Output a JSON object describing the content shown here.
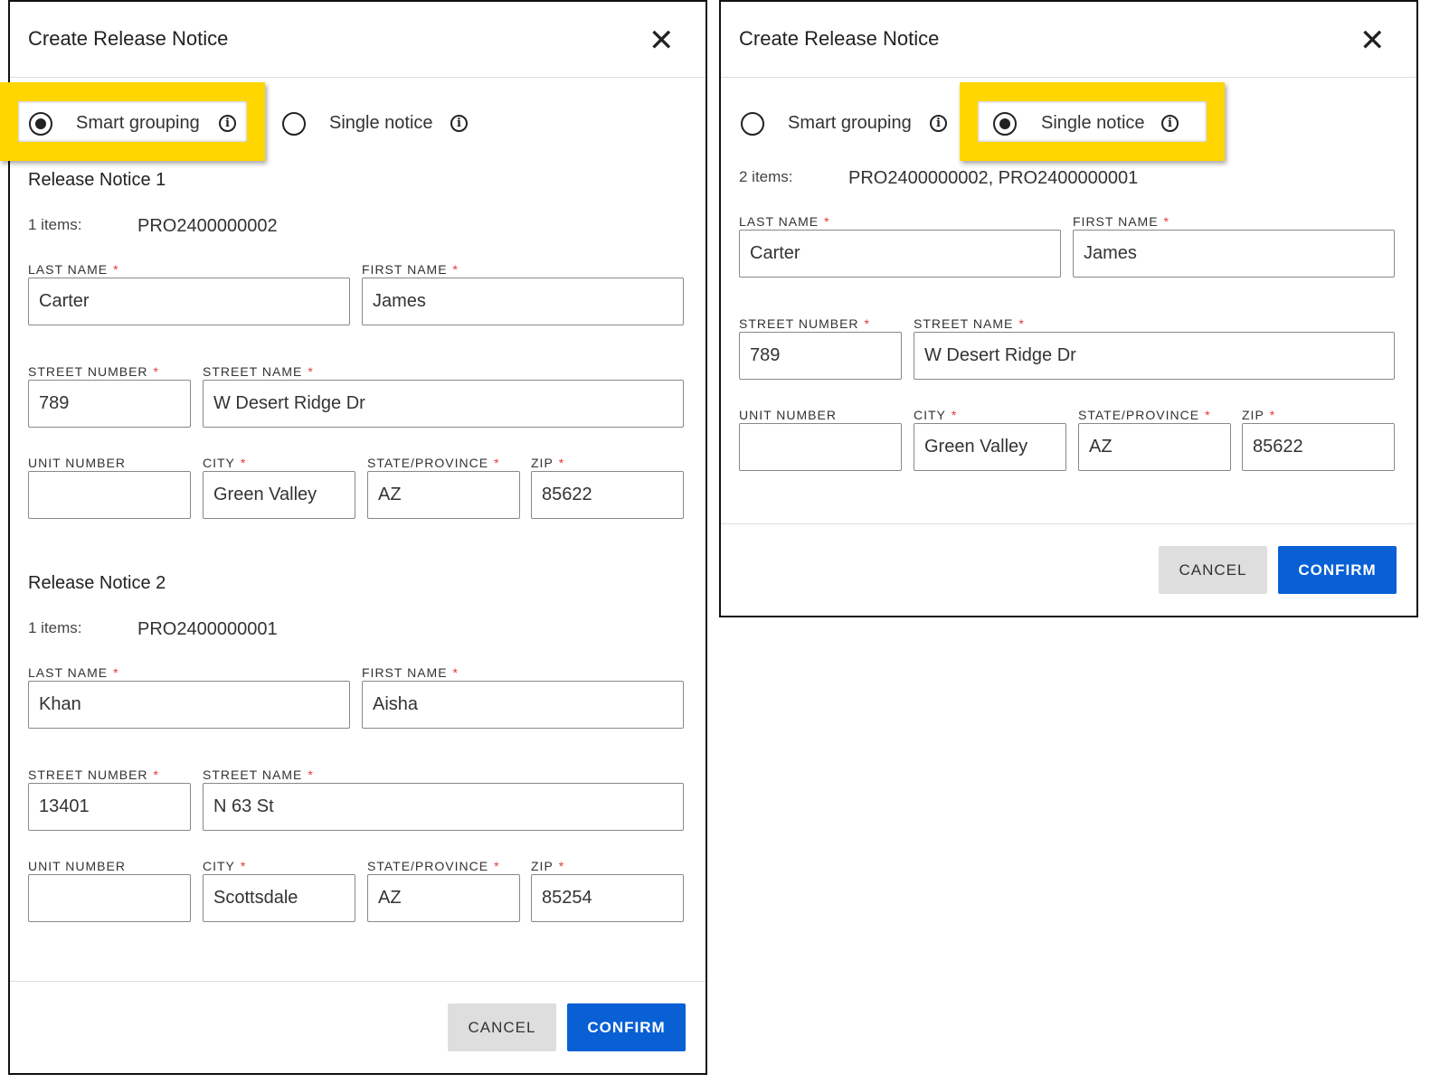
{
  "left": {
    "title": "Create Release Notice",
    "options": [
      {
        "label": "Smart grouping",
        "selected": true
      },
      {
        "label": "Single notice",
        "selected": false
      }
    ],
    "notices": [
      {
        "heading": "Release Notice 1",
        "items_label": "1 items:",
        "items_value": "PRO2400000002",
        "fields": {
          "last_name": {
            "label": "LAST NAME",
            "value": "Carter"
          },
          "first_name": {
            "label": "FIRST NAME",
            "value": "James"
          },
          "street_number": {
            "label": "STREET NUMBER",
            "value": "789"
          },
          "street_name": {
            "label": "STREET NAME",
            "value": "W Desert Ridge Dr"
          },
          "unit_number": {
            "label": "UNIT NUMBER",
            "value": ""
          },
          "city": {
            "label": "CITY",
            "value": "Green Valley"
          },
          "state": {
            "label": "STATE/PROVINCE",
            "value": "AZ"
          },
          "zip": {
            "label": "ZIP",
            "value": "85622"
          }
        }
      },
      {
        "heading": "Release Notice 2",
        "items_label": "1 items:",
        "items_value": "PRO2400000001",
        "fields": {
          "last_name": {
            "label": "LAST NAME",
            "value": "Khan"
          },
          "first_name": {
            "label": "FIRST NAME",
            "value": "Aisha"
          },
          "street_number": {
            "label": "STREET NUMBER",
            "value": "13401"
          },
          "street_name": {
            "label": "STREET NAME",
            "value": "N 63 St"
          },
          "unit_number": {
            "label": "UNIT NUMBER",
            "value": ""
          },
          "city": {
            "label": "CITY",
            "value": "Scottsdale"
          },
          "state": {
            "label": "STATE/PROVINCE",
            "value": "AZ"
          },
          "zip": {
            "label": "ZIP",
            "value": "85254"
          }
        }
      }
    ],
    "cancel": "CANCEL",
    "confirm": "CONFIRM"
  },
  "right": {
    "title": "Create Release Notice",
    "options": [
      {
        "label": "Smart grouping",
        "selected": false
      },
      {
        "label": "Single notice",
        "selected": true
      }
    ],
    "notices": [
      {
        "items_label": "2 items:",
        "items_value": "PRO2400000002, PRO2400000001",
        "fields": {
          "last_name": {
            "label": "LAST NAME",
            "value": "Carter"
          },
          "first_name": {
            "label": "FIRST NAME",
            "value": "James"
          },
          "street_number": {
            "label": "STREET NUMBER",
            "value": "789"
          },
          "street_name": {
            "label": "STREET NAME",
            "value": "W Desert Ridge Dr"
          },
          "unit_number": {
            "label": "UNIT NUMBER",
            "value": ""
          },
          "city": {
            "label": "CITY",
            "value": "Green Valley"
          },
          "state": {
            "label": "STATE/PROVINCE",
            "value": "AZ"
          },
          "zip": {
            "label": "ZIP",
            "value": "85622"
          }
        }
      }
    ],
    "cancel": "CANCEL",
    "confirm": "CONFIRM"
  },
  "icons": {
    "close": "close-icon",
    "info": "info-icon",
    "radio": "radio-button"
  },
  "colors": {
    "highlight": "#ffd600",
    "primary": "#0860d4",
    "required": "#e53935"
  }
}
